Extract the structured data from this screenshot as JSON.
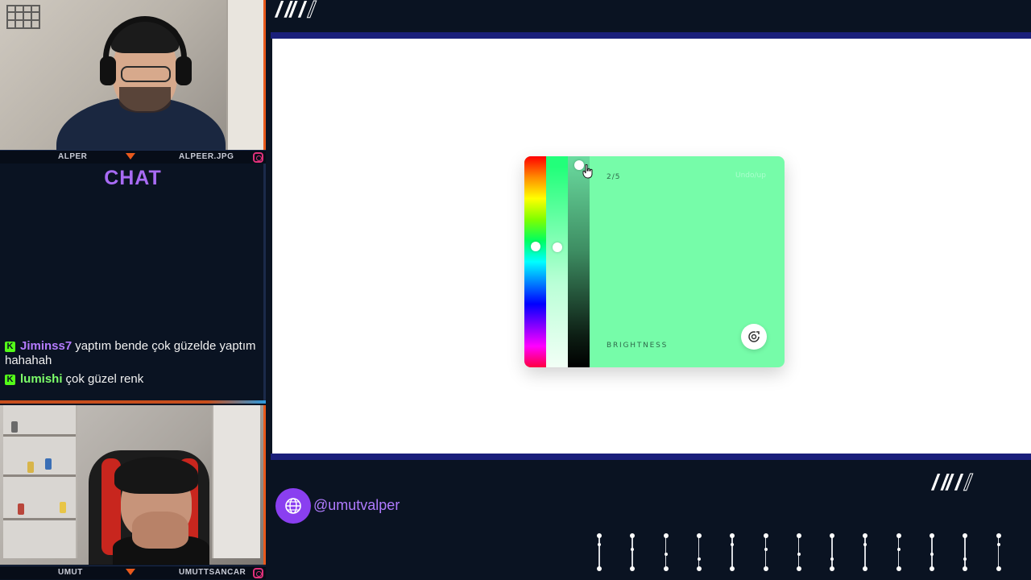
{
  "webcam_top": {
    "name_left": "ALPER",
    "name_right": "ALPEER.JPG"
  },
  "chat": {
    "title": "CHAT",
    "messages": [
      {
        "user": "Jiminss7",
        "text": "yaptım bende çok güzelde yaptım hahahah",
        "user_color": "#b57bff"
      },
      {
        "user": "lumishi",
        "text": "çok güzel renk",
        "user_color": "#7dff6a"
      }
    ]
  },
  "webcam_bottom": {
    "name_left": "UMUT",
    "name_right": "UMUTTSANCAR"
  },
  "picker": {
    "step": "2/5",
    "faint_label": "Undo/up",
    "label": "BRIGHTNESS",
    "color": "#76fca9",
    "action_icon": "refresh-target-icon"
  },
  "social": {
    "handle": "@umutvalper",
    "icon": "globe-icon"
  },
  "colors": {
    "accent_orange": "#e8591c",
    "accent_blue": "#1a1f7a",
    "accent_purple": "#8a3ff0"
  }
}
